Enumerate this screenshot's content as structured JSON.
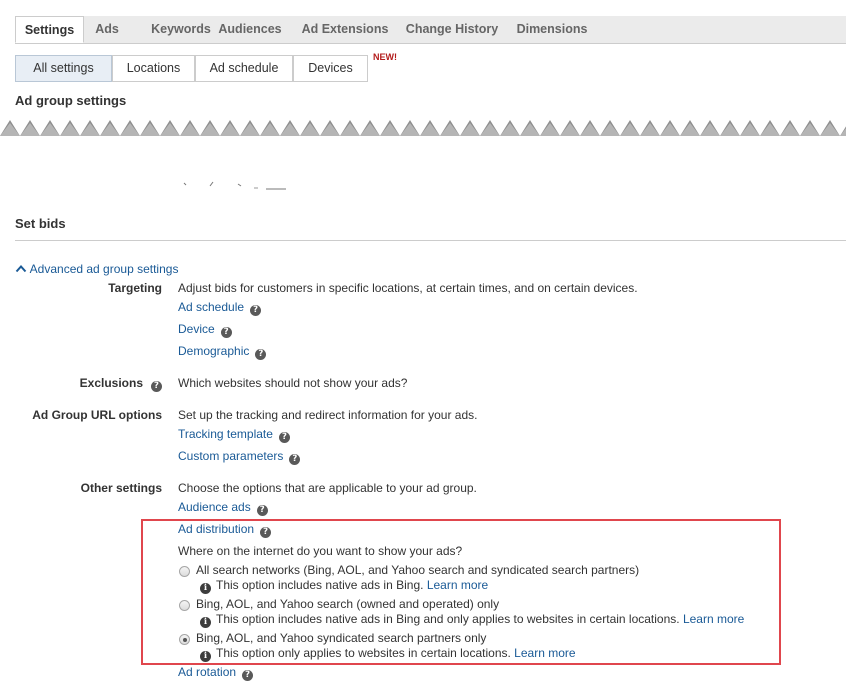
{
  "tabs": [
    {
      "label": "Settings",
      "active": true
    },
    {
      "label": "Ads"
    },
    {
      "label": "Keywords"
    },
    {
      "label": "Audiences"
    },
    {
      "label": "Ad Extensions"
    },
    {
      "label": "Change History"
    },
    {
      "label": "Dimensions"
    }
  ],
  "subtabs": [
    {
      "label": "All settings",
      "active": true
    },
    {
      "label": "Locations"
    },
    {
      "label": "Ad schedule"
    },
    {
      "label": "Devices"
    }
  ],
  "new_badge": "NEW!",
  "ad_group_settings_title": "Ad group settings",
  "set_bids_title": "Set bids",
  "advanced_toggle": "Advanced ad group settings",
  "targeting": {
    "label": "Targeting",
    "description": "Adjust bids for customers in specific locations, at certain times, and on certain devices.",
    "links": [
      "Ad schedule",
      "Device",
      "Demographic"
    ]
  },
  "exclusions": {
    "label": "Exclusions",
    "description": "Which websites should not show your ads?"
  },
  "url_options": {
    "label": "Ad Group URL options",
    "description": "Set up the tracking and redirect information for your ads.",
    "links": [
      "Tracking template",
      "Custom parameters"
    ]
  },
  "other_settings": {
    "label": "Other settings",
    "description": "Choose the options that are applicable to your ad group.",
    "audience_ads": "Audience ads",
    "ad_distribution": "Ad distribution",
    "question": "Where on the internet do you want to show your ads?",
    "options": [
      {
        "label": "All search networks (Bing, AOL, and Yahoo search and syndicated search partners)",
        "info": "This option includes native ads in Bing.",
        "learn_more": "Learn more",
        "checked": false
      },
      {
        "label": "Bing, AOL, and Yahoo search (owned and operated) only",
        "info": "This option includes native ads in Bing and only applies to websites in certain locations.",
        "learn_more": "Learn more",
        "checked": false
      },
      {
        "label": "Bing, AOL, and Yahoo syndicated search partners only",
        "info": "This option only applies to websites in certain locations.",
        "learn_more": "Learn more",
        "checked": true
      }
    ],
    "ad_rotation": "Ad rotation"
  },
  "icons": {
    "help": "?",
    "info": "i",
    "chevron": "^"
  },
  "colors": {
    "link": "#1a5a96",
    "highlight_box": "#e0464d",
    "new_badge": "#b31b1b"
  }
}
